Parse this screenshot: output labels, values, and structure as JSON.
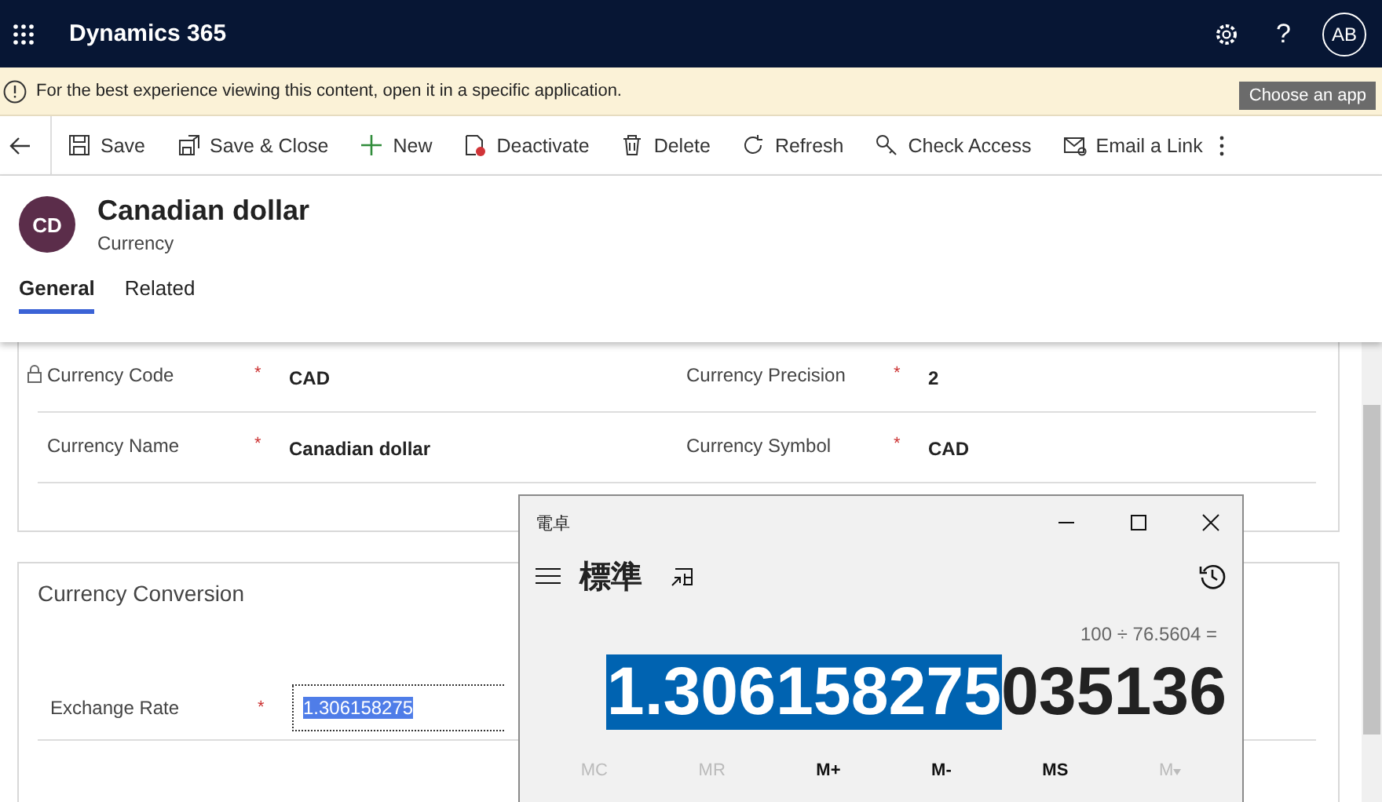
{
  "app": {
    "title": "Dynamics 365",
    "avatar": "AB",
    "help": "?"
  },
  "notice": {
    "text": "For the best experience viewing this content, open it in a specific application.",
    "button": "Choose an app"
  },
  "commands": [
    {
      "label": "Save"
    },
    {
      "label": "Save & Close"
    },
    {
      "label": "New"
    },
    {
      "label": "Deactivate"
    },
    {
      "label": "Delete"
    },
    {
      "label": "Refresh"
    },
    {
      "label": "Check Access"
    },
    {
      "label": "Email a Link"
    }
  ],
  "record": {
    "initials": "CD",
    "title": "Canadian dollar",
    "entity": "Currency"
  },
  "tabs": [
    {
      "label": "General",
      "selected": true
    },
    {
      "label": "Related",
      "selected": false
    }
  ],
  "general_fields": [
    [
      {
        "label": "Currency Code",
        "locked": true,
        "required": "*",
        "value": "CAD"
      },
      {
        "label": "Currency Precision",
        "locked": false,
        "required": "*",
        "value": "2"
      }
    ],
    [
      {
        "label": "Currency Name",
        "locked": false,
        "required": "*",
        "value": "Canadian dollar"
      },
      {
        "label": "Currency Symbol",
        "locked": false,
        "required": "*",
        "value": "CAD"
      }
    ]
  ],
  "conversion": {
    "title": "Currency Conversion",
    "label": "Exchange Rate",
    "required": "*",
    "value": "1.306158275"
  },
  "calculator": {
    "title": "電卓",
    "mode": "標準",
    "expression": "100 ÷ 76.5604 =",
    "selected_part": "1.306158275",
    "rest": "035136",
    "memory": [
      {
        "label": "MC",
        "disabled": true
      },
      {
        "label": "MR",
        "disabled": true
      },
      {
        "label": "M+",
        "disabled": false
      },
      {
        "label": "M-",
        "disabled": false
      },
      {
        "label": "MS",
        "disabled": false
      },
      {
        "label": "M",
        "disabled": true
      }
    ]
  }
}
